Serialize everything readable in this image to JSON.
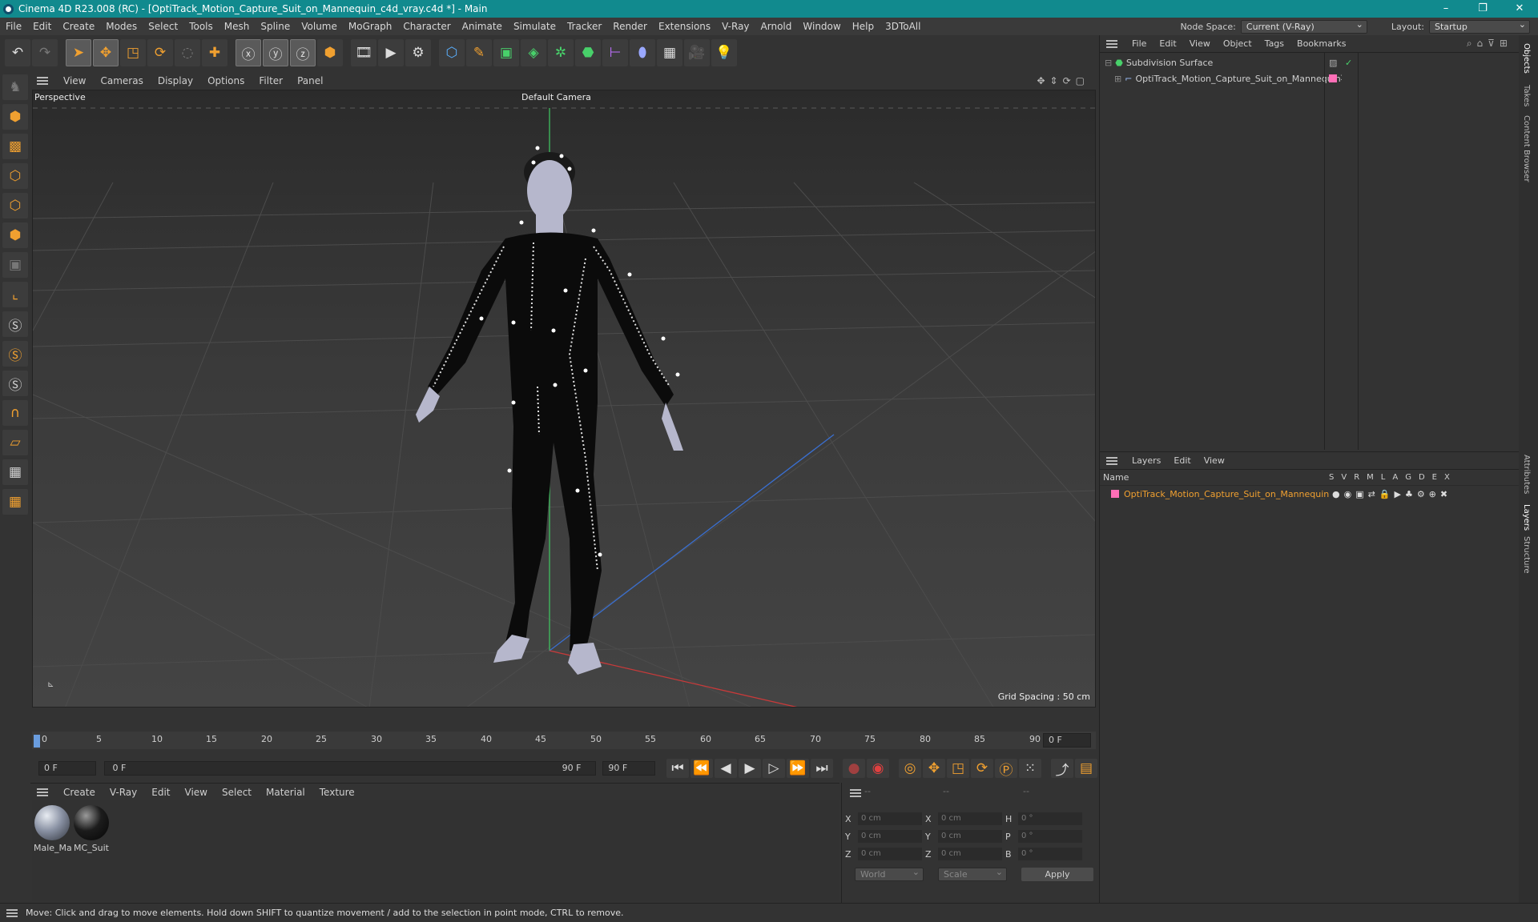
{
  "window": {
    "title": "Cinema 4D R23.008 (RC) - [OptiTrack_Motion_Capture_Suit_on_Mannequin_c4d_vray.c4d *] - Main",
    "controls": [
      "–",
      "❐",
      "✕"
    ]
  },
  "menubar": {
    "items": [
      "File",
      "Edit",
      "Create",
      "Modes",
      "Select",
      "Tools",
      "Mesh",
      "Spline",
      "Volume",
      "MoGraph",
      "Character",
      "Animate",
      "Simulate",
      "Tracker",
      "Render",
      "Extensions",
      "V-Ray",
      "Arnold",
      "Window",
      "Help",
      "3DToAll"
    ],
    "node_space_label": "Node Space:",
    "node_space_value": "Current (V-Ray)",
    "layout_label": "Layout:",
    "layout_value": "Startup"
  },
  "viewport": {
    "menu": [
      "View",
      "Cameras",
      "Display",
      "Options",
      "Filter",
      "Panel"
    ],
    "view_name": "Perspective",
    "camera": "Default Camera",
    "grid_spacing": "Grid Spacing : 50 cm"
  },
  "timeline": {
    "ticks": [
      "0",
      "5",
      "10",
      "15",
      "20",
      "25",
      "30",
      "35",
      "40",
      "45",
      "50",
      "55",
      "60",
      "65",
      "70",
      "75",
      "80",
      "85",
      "90"
    ],
    "current_frame": "0 F"
  },
  "transport": {
    "start": "0 F",
    "range_start": "0 F",
    "range_end": "90 F",
    "end": "90 F"
  },
  "materials": {
    "menu": [
      "Create",
      "V-Ray",
      "Edit",
      "View",
      "Select",
      "Material",
      "Texture"
    ],
    "items": [
      {
        "name": "Male_Ma"
      },
      {
        "name": "MC_Suit"
      }
    ]
  },
  "coords": {
    "headers": [
      "--",
      "--",
      "--"
    ],
    "rows": [
      {
        "a": "X",
        "av": "0 cm",
        "b": "X",
        "bv": "0 cm",
        "c": "H",
        "cv": "0 °"
      },
      {
        "a": "Y",
        "av": "0 cm",
        "b": "Y",
        "bv": "0 cm",
        "c": "P",
        "cv": "0 °"
      },
      {
        "a": "Z",
        "av": "0 cm",
        "b": "Z",
        "bv": "0 cm",
        "c": "B",
        "cv": "0 °"
      }
    ],
    "world": "World",
    "scale": "Scale",
    "apply": "Apply"
  },
  "objects": {
    "menu": [
      "File",
      "Edit",
      "View",
      "Object",
      "Tags",
      "Bookmarks"
    ],
    "items": [
      {
        "name": "Subdivision Surface"
      },
      {
        "name": "OptiTrack_Motion_Capture_Suit_on_Mannequin"
      }
    ]
  },
  "layers": {
    "menu": [
      "Layers",
      "Edit",
      "View"
    ],
    "name_header": "Name",
    "flags": [
      "S",
      "V",
      "R",
      "M",
      "L",
      "A",
      "G",
      "D",
      "E",
      "X"
    ],
    "items": [
      {
        "name": "OptiTrack_Motion_Capture_Suit_on_Mannequin"
      }
    ]
  },
  "sidetabs": [
    "Objects",
    "Takes",
    "Content Browser",
    "Attributes",
    "Layers",
    "Structure"
  ],
  "status": "Move: Click and drag to move elements. Hold down SHIFT to quantize movement / add to the selection in point mode, CTRL to remove."
}
